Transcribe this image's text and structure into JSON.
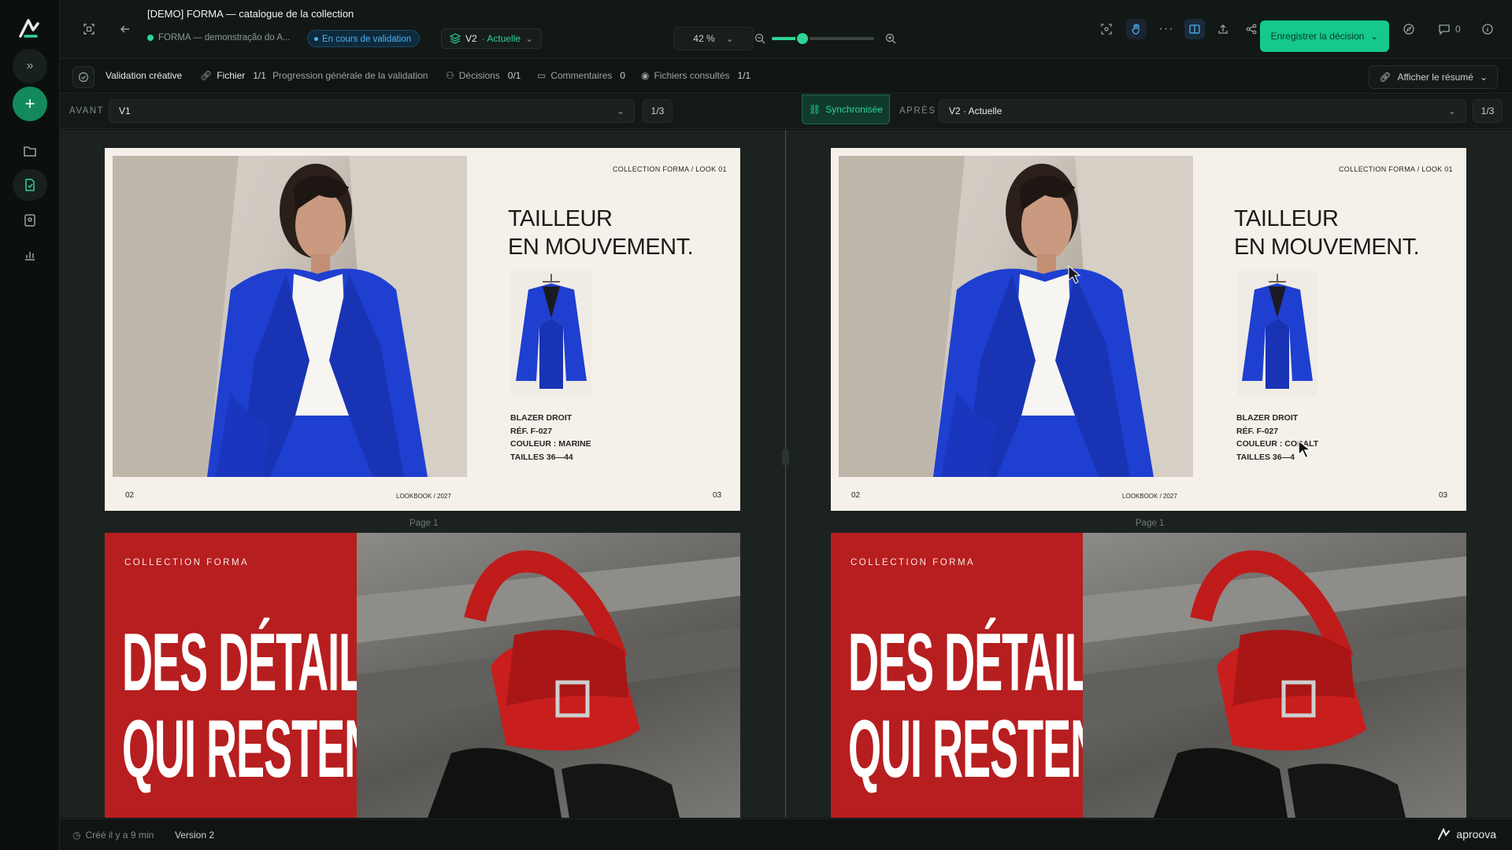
{
  "header": {
    "title": "[DEMO] FORMA — catalogue de la collection",
    "project": "FORMA — demonstração do A...",
    "status": "En cours de validation",
    "version_name": "V2",
    "version_state": "· Actuelle",
    "zoom": "42 %",
    "zoom_level": 0.3,
    "save_button": "Enregistrer la décision",
    "comments_count": "0"
  },
  "summary": {
    "validation": "Validation créative",
    "file_label": "Fichier",
    "file_value": "1/1",
    "progress": "Progression générale de la validation",
    "decisions_label": "Décisions",
    "decisions_value": "0/1",
    "comments_label": "Commentaires",
    "comments_value": "0",
    "viewed_label": "Fichiers consultés",
    "viewed_value": "1/1",
    "resume_button": "Afficher le résumé"
  },
  "compare": {
    "before_label": "AVANT",
    "before_version": "V1",
    "before_page": "1/3",
    "after_label": "APRÈS",
    "after_version": "V2 · Actuelle",
    "after_page": "1/3",
    "sync": "Synchronisée"
  },
  "slides": {
    "left": {
      "kicker": "COLLECTION FORMA / LOOK 01",
      "title_line1": "TAILLEUR",
      "title_line2": "EN MOUVEMENT.",
      "meta1": "BLAZER DROIT",
      "meta2": "RÉF. F-027",
      "meta3": "COULEUR : MARINE",
      "meta4": "TAILLES 36—44",
      "page_left": "02",
      "footer": "LOOKBOOK / 2027",
      "page_right": "03",
      "page_label": "Page 1"
    },
    "right": {
      "kicker": "COLLECTION FORMA / LOOK 01",
      "title_line1": "TAILLEUR",
      "title_line2": "EN MOUVEMENT.",
      "meta1": "BLAZER DROIT",
      "meta2": "RÉF. F-027",
      "meta3": "COULEUR : COBALT",
      "meta4": "TAILLES 36—4",
      "page_left": "02",
      "footer": "LOOKBOOK / 2027",
      "page_right": "03",
      "page_label": "Page 1"
    },
    "second": {
      "kicker": "COLLECTION FORMA",
      "headline_line1": "DES DÉTAILS",
      "headline_line2": "QUI RESTENT."
    }
  },
  "statusbar": {
    "created": "Créé il y a 9 min",
    "version": "Version 2",
    "brand": "aproova"
  },
  "colors": {
    "accent": "#14c98a",
    "status_blue": "#4fb3f0",
    "poster_red": "#b71e1f",
    "cobalt": "#1f3fd1"
  }
}
